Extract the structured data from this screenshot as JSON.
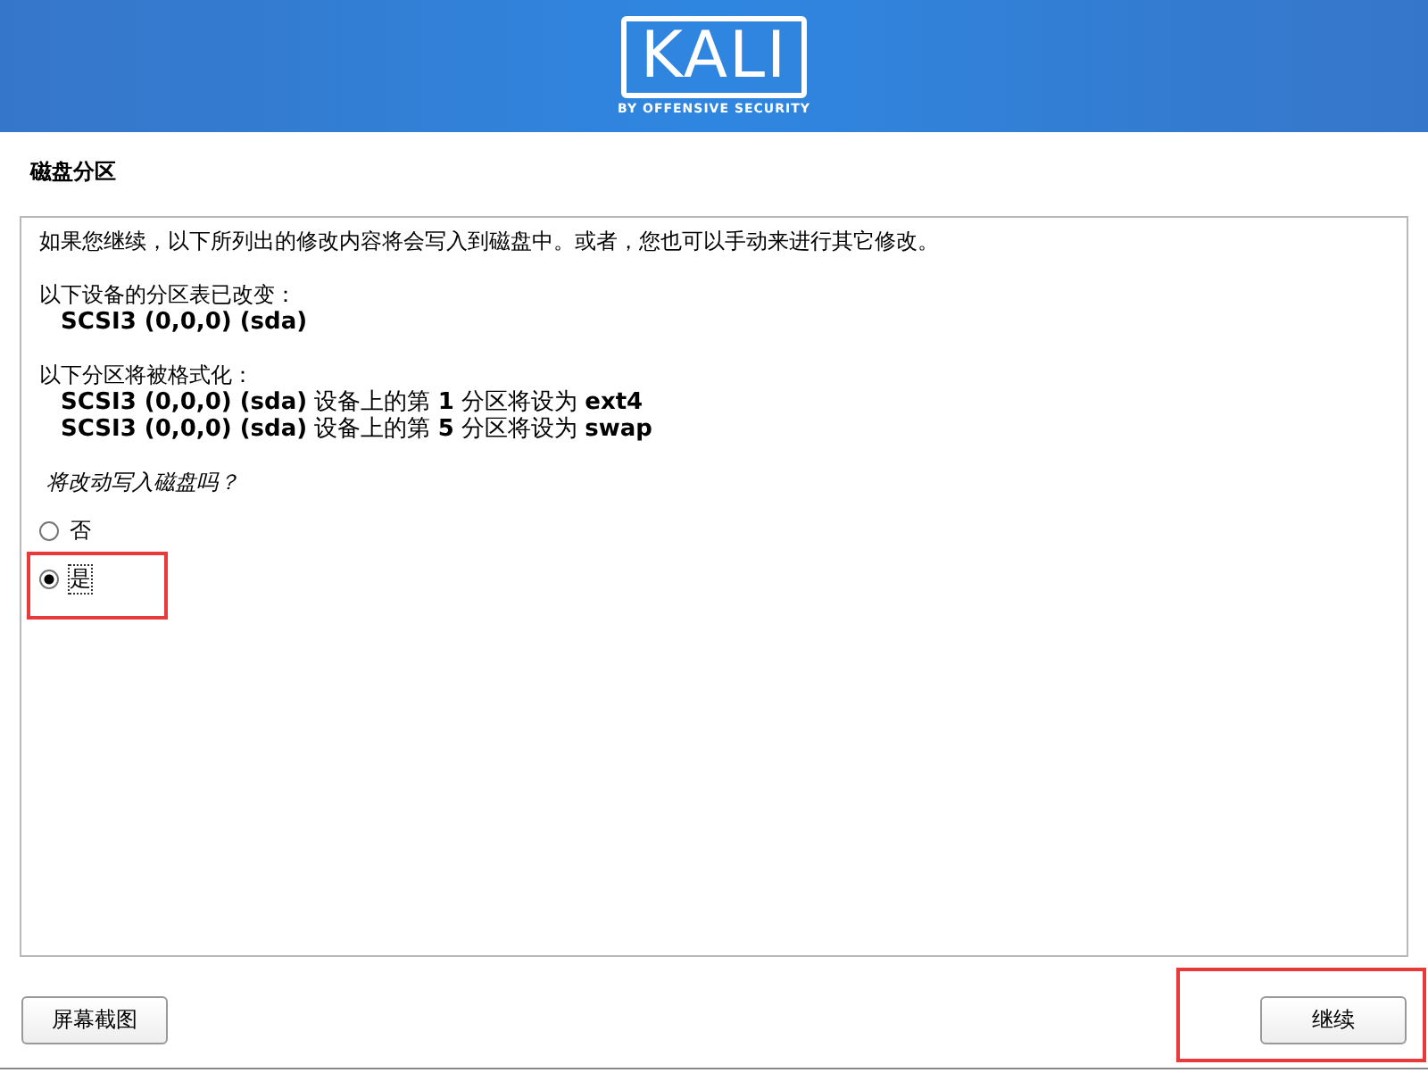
{
  "header": {
    "logo": "KALI",
    "tagline": "BY OFFENSIVE SECURITY"
  },
  "title": "磁盘分区",
  "intro": "如果您继续，以下所列出的修改内容将会写入到磁盘中。或者，您也可以手动来进行其它修改。",
  "sections": [
    {
      "heading": "以下设备的分区表已改变：",
      "lines": [
        "**SCSI3 (0,0,0) (sda)**"
      ]
    },
    {
      "heading": "以下分区将被格式化：",
      "lines": [
        "**SCSI3 (0,0,0) (sda)** 设备上的第 **1** 分区将设为 **ext4**",
        "**SCSI3 (0,0,0) (sda)** 设备上的第 **5** 分区将设为 **swap**"
      ]
    }
  ],
  "question": "将改动写入磁盘吗？",
  "options": [
    {
      "label": "否",
      "selected": false,
      "highlighted": false
    },
    {
      "label": "是",
      "selected": true,
      "highlighted": true
    }
  ],
  "buttons": [
    {
      "label": "屏幕截图",
      "highlighted": false
    },
    {
      "label": "继续",
      "highlighted": true
    }
  ]
}
